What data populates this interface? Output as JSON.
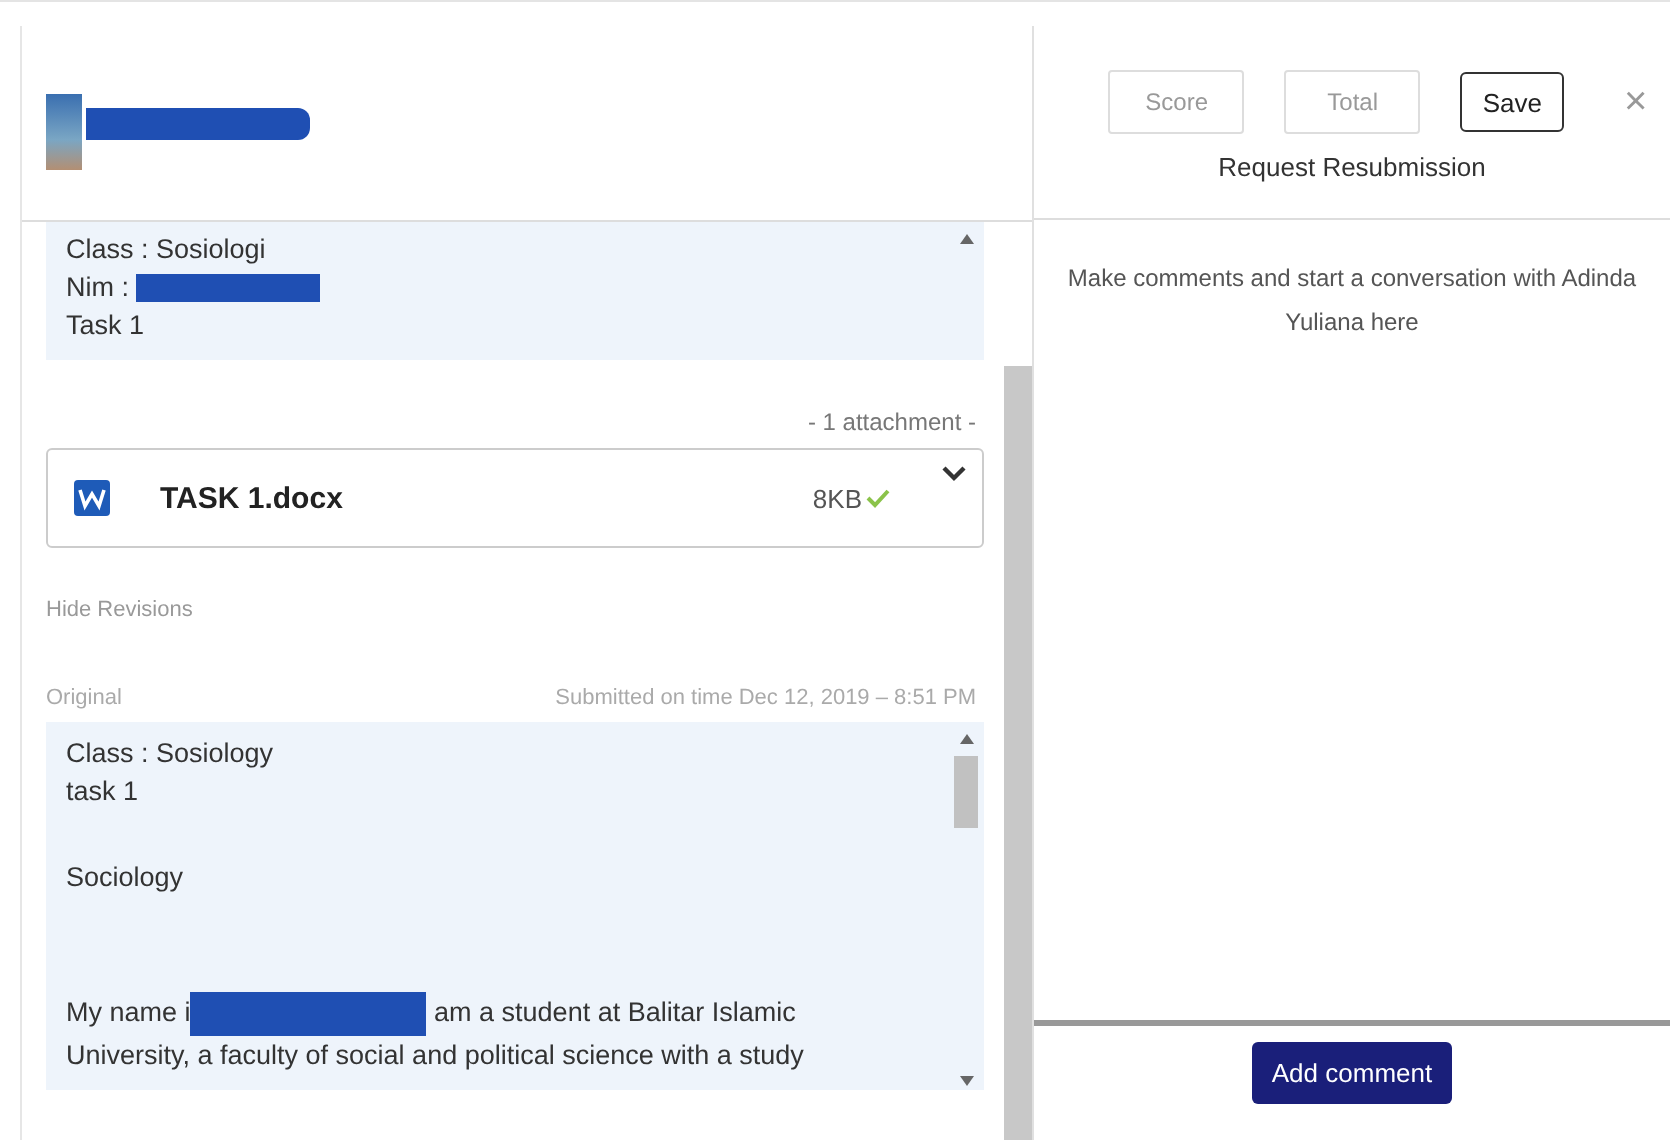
{
  "submission": {
    "body_lines": [
      [
        {
          "kind": "text",
          "text": "Class : Sosiologi"
        }
      ],
      [
        {
          "kind": "text",
          "text": "Nim : "
        },
        {
          "kind": "redaction"
        }
      ],
      [
        {
          "kind": "text",
          "text": "Task 1"
        }
      ]
    ],
    "attachment_count": "- 1 attachment -",
    "attachment": {
      "name": "TASK 1.docx",
      "size": "8KB",
      "verified": true
    },
    "revisions_toggle": "Hide Revisions",
    "original_label": "Original",
    "submitted_status": "Submitted on time Dec 12, 2019 – 8:51 PM",
    "original_lines": [
      [
        {
          "kind": "text",
          "text": "Class : Sosiology"
        }
      ],
      [
        {
          "kind": "text",
          "text": "task 1"
        }
      ],
      [
        {
          "kind": "blank"
        }
      ],
      [
        {
          "kind": "text",
          "text": "Sociology"
        }
      ],
      [
        {
          "kind": "blank"
        }
      ],
      [
        {
          "kind": "blank"
        }
      ],
      [
        {
          "kind": "text",
          "text": "My name i"
        },
        {
          "kind": "redaction"
        },
        {
          "kind": "text",
          "text": " am a student at Balitar Islamic"
        }
      ],
      [
        {
          "kind": "text",
          "text": "University, a faculty of social and political science with a study"
        }
      ]
    ]
  },
  "grading": {
    "score": {
      "placeholder": "Score"
    },
    "total": {
      "placeholder": "Total"
    },
    "save": "Save",
    "close": "×",
    "resubmit": "Request Resubmission"
  },
  "comments": {
    "empty_text": "Make comments and start a conversation with Adinda Yuliana here",
    "add_button": "Add comment"
  }
}
